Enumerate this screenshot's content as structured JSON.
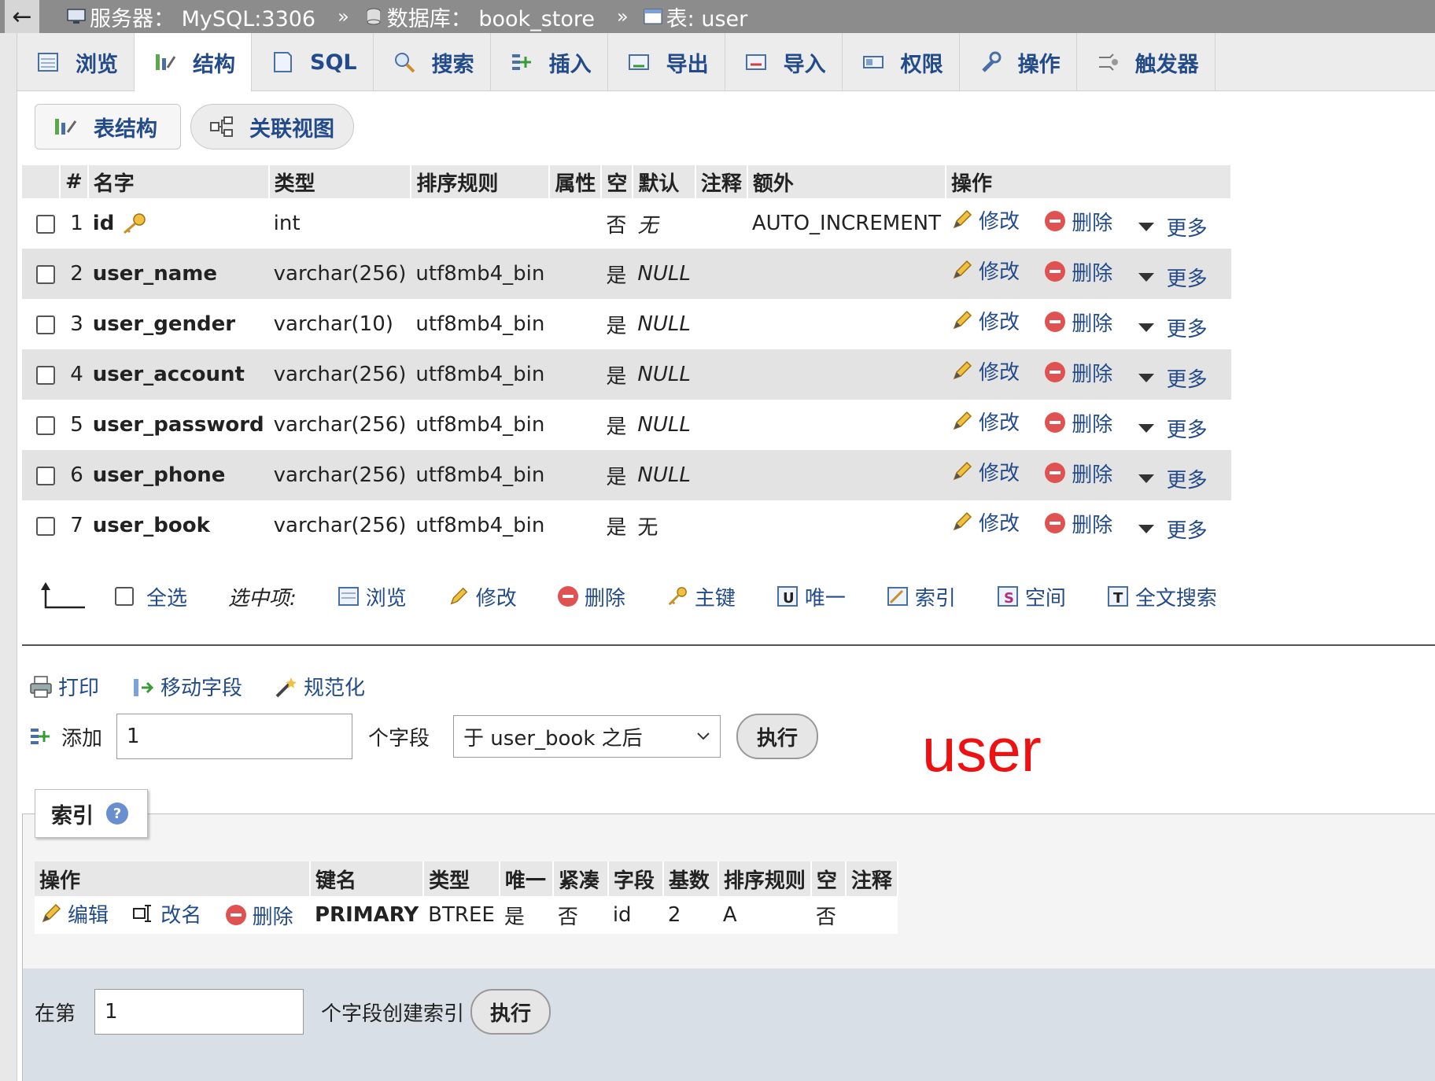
{
  "breadcrumb": {
    "back": "←",
    "server": "服务器： MySQL:3306",
    "database": "数据库： book_store",
    "table": "表: user",
    "sep": "»"
  },
  "tabs": [
    "浏览",
    "结构",
    "SQL",
    "搜索",
    "插入",
    "导出",
    "导入",
    "权限",
    "操作",
    "触发器"
  ],
  "subtabs": {
    "structure": "表结构",
    "relation": "关联视图"
  },
  "columns": {
    "num": "#",
    "name": "名字",
    "type": "类型",
    "collation": "排序规则",
    "attributes": "属性",
    "null": "空",
    "default": "默认",
    "comment": "注释",
    "extra": "额外",
    "action": "操作"
  },
  "actions": {
    "edit": "修改",
    "delete": "删除",
    "more": "更多"
  },
  "rows": [
    {
      "num": "1",
      "name": "id",
      "type": "int",
      "collation": "",
      "null": "否",
      "default": "无",
      "default_italic": true,
      "extra": "AUTO_INCREMENT"
    },
    {
      "num": "2",
      "name": "user_name",
      "type": "varchar(256)",
      "collation": "utf8mb4_bin",
      "null": "是",
      "default": "NULL",
      "default_italic": true,
      "extra": ""
    },
    {
      "num": "3",
      "name": "user_gender",
      "type": "varchar(10)",
      "collation": "utf8mb4_bin",
      "null": "是",
      "default": "NULL",
      "default_italic": true,
      "extra": ""
    },
    {
      "num": "4",
      "name": "user_account",
      "type": "varchar(256)",
      "collation": "utf8mb4_bin",
      "null": "是",
      "default": "NULL",
      "default_italic": true,
      "extra": ""
    },
    {
      "num": "5",
      "name": "user_password",
      "type": "varchar(256)",
      "collation": "utf8mb4_bin",
      "null": "是",
      "default": "NULL",
      "default_italic": true,
      "extra": ""
    },
    {
      "num": "6",
      "name": "user_phone",
      "type": "varchar(256)",
      "collation": "utf8mb4_bin",
      "null": "是",
      "default": "NULL",
      "default_italic": true,
      "extra": ""
    },
    {
      "num": "7",
      "name": "user_book",
      "type": "varchar(256)",
      "collation": "utf8mb4_bin",
      "null": "是",
      "default": "无",
      "default_italic": false,
      "extra": ""
    }
  ],
  "bulk": {
    "select_all": "全选",
    "with_selected": "选中项:",
    "browse": "浏览",
    "edit": "修改",
    "delete": "删除",
    "primary": "主键",
    "unique": "唯一",
    "index": "索引",
    "spatial": "空间",
    "fulltext": "全文搜索"
  },
  "tools": {
    "print": "打印",
    "move": "移动字段",
    "normalize": "规范化"
  },
  "add": {
    "label": "添加",
    "value": "1",
    "unit": "个字段",
    "position": "于 user_book 之后",
    "go": "执行"
  },
  "annotation": "user",
  "indexes": {
    "legend": "索引",
    "headers": {
      "action": "操作",
      "keyname": "键名",
      "type": "类型",
      "unique": "唯一",
      "packed": "紧凑",
      "column": "字段",
      "cardinality": "基数",
      "collation": "排序规则",
      "null": "空",
      "comment": "注释"
    },
    "actions": {
      "edit": "编辑",
      "rename": "改名",
      "delete": "删除"
    },
    "row": {
      "keyname": "PRIMARY",
      "type": "BTREE",
      "unique": "是",
      "packed": "否",
      "column": "id",
      "cardinality": "2",
      "collation": "A",
      "null": "否",
      "comment": ""
    }
  },
  "create_index": {
    "prefix": "在第",
    "value": "1",
    "suffix": "个字段创建索引",
    "go": "执行"
  }
}
